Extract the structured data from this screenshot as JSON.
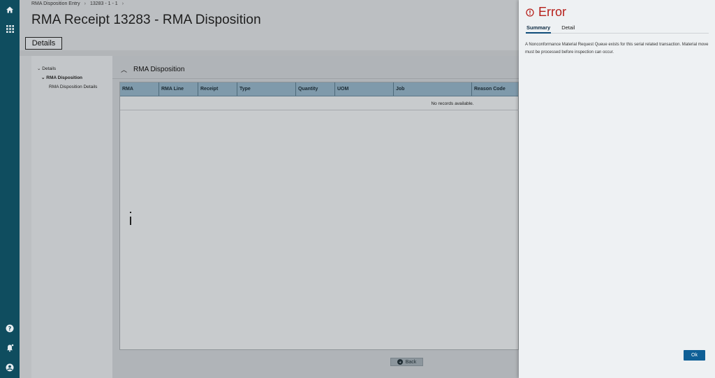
{
  "breadcrumb": [
    "RMA Disposition Entry",
    "13283 - 1 - 1"
  ],
  "breadcrumb_sep": "›",
  "page_title": "RMA Receipt 13283 - RMA Disposition",
  "tab_label": "Details",
  "tree": {
    "root": "Details",
    "child": "RMA Disposition",
    "grandchild": "RMA Disposition Details"
  },
  "panel_title": "RMA Disposition",
  "grid": {
    "columns": [
      "RMA",
      "RMA Line",
      "Receipt",
      "Type",
      "Quantity",
      "UOM",
      "Job",
      "Reason Code"
    ],
    "empty_text": "No records available."
  },
  "back_label": "Back",
  "error": {
    "title": "Error",
    "tabs": [
      "Summary",
      "Detail"
    ],
    "message": "A Nonconformance Material Request Queue exists for this serial related transaction. Material move must be processed before inspection can occur.",
    "ok_label": "Ok",
    "color": "#b6201b"
  },
  "rail_icons": [
    "home-icon",
    "apps-grid-icon",
    "help-icon",
    "notifications-icon",
    "user-icon"
  ]
}
